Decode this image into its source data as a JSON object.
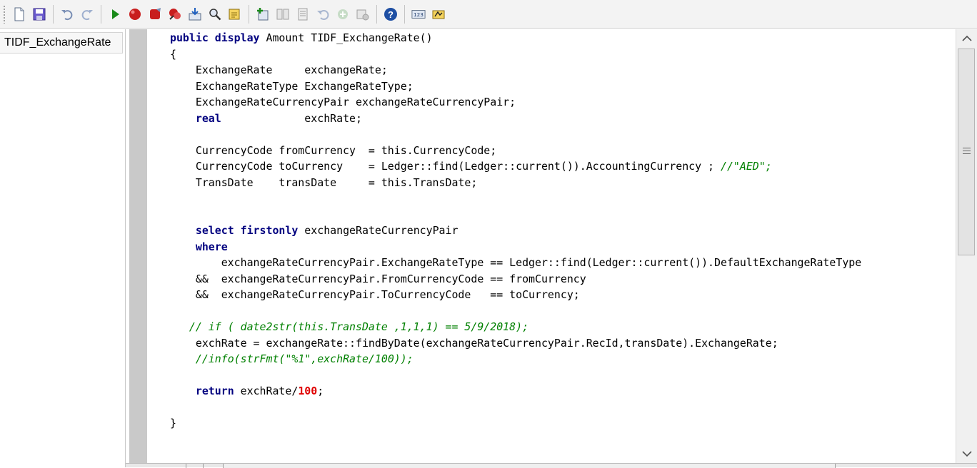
{
  "toolbar": {
    "buttons": [
      {
        "id": "new",
        "icon": "new-document-icon"
      },
      {
        "id": "save",
        "icon": "save-icon"
      },
      {
        "id": "undo",
        "icon": "undo-icon"
      },
      {
        "id": "redo",
        "icon": "redo-icon"
      },
      {
        "id": "run",
        "icon": "run-icon"
      },
      {
        "id": "breakpoint",
        "icon": "breakpoint-icon"
      },
      {
        "id": "stop",
        "icon": "stop-icon"
      },
      {
        "id": "remove-breakpoints",
        "icon": "remove-breakpoints-icon"
      },
      {
        "id": "import",
        "icon": "import-icon"
      },
      {
        "id": "find",
        "icon": "find-icon"
      },
      {
        "id": "lookup",
        "icon": "lookup-icon"
      },
      {
        "id": "add-item",
        "icon": "add-item-icon"
      },
      {
        "id": "compare",
        "icon": "compare-icon"
      },
      {
        "id": "scripts",
        "icon": "scripts-icon"
      },
      {
        "id": "go-back",
        "icon": "go-back-icon"
      },
      {
        "id": "add-circle",
        "icon": "add-circle-icon"
      },
      {
        "id": "settings",
        "icon": "settings-icon"
      },
      {
        "id": "help",
        "icon": "help-icon"
      },
      {
        "id": "line-numbers",
        "icon": "line-numbers-icon",
        "label": "123"
      },
      {
        "id": "macro",
        "icon": "macro-icon"
      }
    ],
    "colors": {
      "help": "#1e4fa3",
      "run": "#1a8a1a",
      "record": "#c81e1e"
    }
  },
  "tree": {
    "method_name": "TIDF_ExchangeRate"
  },
  "code": {
    "lines": [
      [
        {
          "t": "public display",
          "c": "kw"
        },
        {
          "t": " Amount TIDF_ExchangeRate()"
        }
      ],
      [
        {
          "t": "{"
        }
      ],
      [
        {
          "t": "    ExchangeRate     exchangeRate;"
        }
      ],
      [
        {
          "t": "    ExchangeRateType ExchangeRateType;"
        }
      ],
      [
        {
          "t": "    ExchangeRateCurrencyPair exchangeRateCurrencyPair;"
        }
      ],
      [
        {
          "t": "    "
        },
        {
          "t": "real",
          "c": "kw"
        },
        {
          "t": "             exchRate;"
        }
      ],
      [
        {
          "t": ""
        }
      ],
      [
        {
          "t": "    CurrencyCode fromCurrency  = this.CurrencyCode;"
        }
      ],
      [
        {
          "t": "    CurrencyCode toCurrency    = Ledger::find(Ledger::current()).AccountingCurrency ; "
        },
        {
          "t": "//\"AED\";",
          "c": "cm"
        }
      ],
      [
        {
          "t": "    TransDate    transDate     = this.TransDate;"
        }
      ],
      [
        {
          "t": ""
        }
      ],
      [
        {
          "t": ""
        }
      ],
      [
        {
          "t": "    "
        },
        {
          "t": "select firstonly",
          "c": "kw"
        },
        {
          "t": " exchangeRateCurrencyPair"
        }
      ],
      [
        {
          "t": "    "
        },
        {
          "t": "where",
          "c": "kw"
        }
      ],
      [
        {
          "t": "        exchangeRateCurrencyPair.ExchangeRateType == Ledger::find(Ledger::current()).DefaultExchangeRateType"
        }
      ],
      [
        {
          "t": "    &&  exchangeRateCurrencyPair.FromCurrencyCode == fromCurrency"
        }
      ],
      [
        {
          "t": "    &&  exchangeRateCurrencyPair.ToCurrencyCode   == toCurrency;"
        }
      ],
      [
        {
          "t": ""
        }
      ],
      [
        {
          "t": "   "
        },
        {
          "t": "// if ( date2str(this.TransDate ,1,1,1) == 5/9/2018);",
          "c": "cm"
        }
      ],
      [
        {
          "t": "    exchRate = exchangeRate::findByDate(exchangeRateCurrencyPair.RecId,transDate).ExchangeRate;"
        }
      ],
      [
        {
          "t": "    "
        },
        {
          "t": "//info(strFmt(\"%1\",exchRate/100));",
          "c": "cm"
        }
      ],
      [
        {
          "t": ""
        }
      ],
      [
        {
          "t": "    "
        },
        {
          "t": "return",
          "c": "kw"
        },
        {
          "t": " exchRate/"
        },
        {
          "t": "100",
          "c": "num"
        },
        {
          "t": ";"
        }
      ],
      [
        {
          "t": ""
        }
      ],
      [
        {
          "t": "}"
        }
      ]
    ]
  },
  "scrollbar": {
    "up_icon": "scroll-up-arrow-icon",
    "down_icon": "scroll-down-arrow-icon",
    "position": 0
  }
}
